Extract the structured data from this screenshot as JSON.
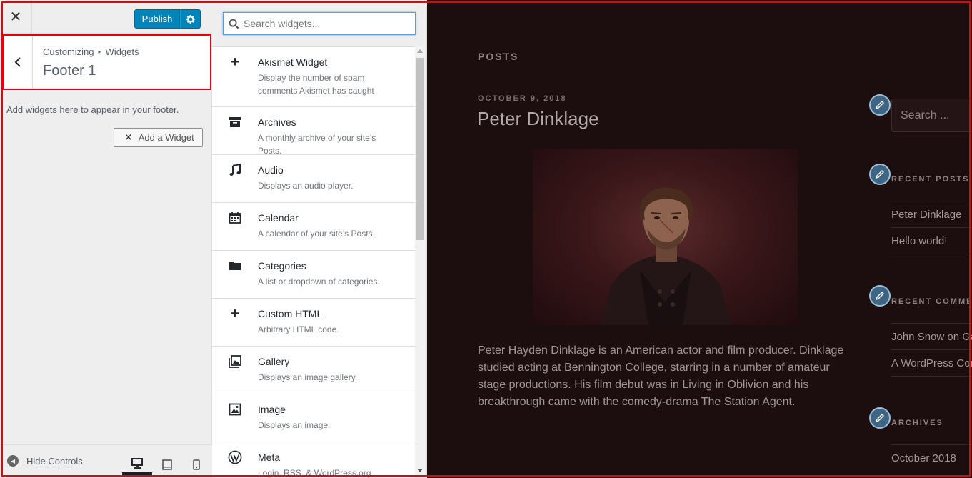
{
  "header": {
    "publish_label": "Publish"
  },
  "section": {
    "breadcrumb_root": "Customizing",
    "breadcrumb_child": "Widgets",
    "title": "Footer 1",
    "description": "Add widgets here to appear in your footer.",
    "add_widget_label": "Add a Widget"
  },
  "footer": {
    "hide_controls_label": "Hide Controls"
  },
  "widget_search": {
    "placeholder": "Search widgets..."
  },
  "widgets": [
    {
      "icon": "plus-icon",
      "title": "Akismet Widget",
      "desc": "Display the number of spam comments Akismet has caught"
    },
    {
      "icon": "archive-icon",
      "title": "Archives",
      "desc": "A monthly archive of your site’s Posts."
    },
    {
      "icon": "music-note-icon",
      "title": "Audio",
      "desc": "Displays an audio player."
    },
    {
      "icon": "calendar-icon",
      "title": "Calendar",
      "desc": "A calendar of your site’s Posts."
    },
    {
      "icon": "folder-icon",
      "title": "Categories",
      "desc": "A list or dropdown of categories."
    },
    {
      "icon": "plus-icon",
      "title": "Custom HTML",
      "desc": "Arbitrary HTML code."
    },
    {
      "icon": "gallery-icon",
      "title": "Gallery",
      "desc": "Displays an image gallery."
    },
    {
      "icon": "image-icon",
      "title": "Image",
      "desc": "Displays an image."
    },
    {
      "icon": "wordpress-icon",
      "title": "Meta",
      "desc": "Login, RSS, & WordPress.org links."
    }
  ],
  "preview": {
    "posts_label": "POSTS",
    "post_date": "OCTOBER 9, 2018",
    "post_title": "Peter Dinklage",
    "post_text": "Peter Hayden Dinklage is an American actor and film producer. Dinklage studied acting at Bennington College, starring in a number of amateur stage productions. His film debut was in Living in Oblivion and his breakthrough came with the comedy-drama The Station Agent.",
    "sidebar": {
      "search_placeholder": "Search ...",
      "recent_posts_heading": "RECENT POSTS",
      "recent_posts": [
        "Peter Dinklage",
        "Hello world!"
      ],
      "recent_comments_heading": "RECENT COMMENTS",
      "recent_comments": [
        "John Snow on Game",
        "A WordPress Commenter"
      ],
      "archives_heading": "ARCHIVES",
      "archives": [
        "October 2018"
      ]
    }
  }
}
